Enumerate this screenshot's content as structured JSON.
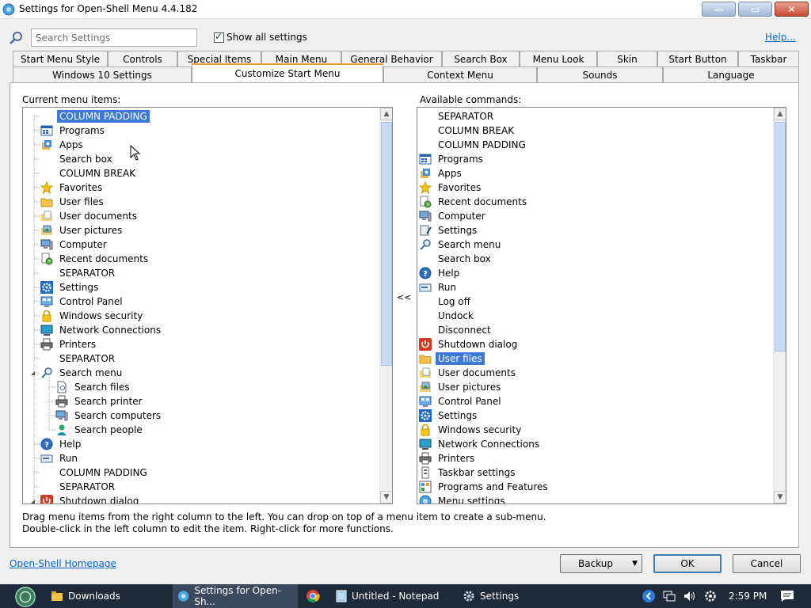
{
  "window": {
    "title": "Settings for Open-Shell Menu 4.4.182",
    "min_label": "—",
    "max_label": "▭",
    "close_label": "✕"
  },
  "search": {
    "placeholder": "Search Settings",
    "show_all_label": "Show all settings",
    "help_label": "Help..."
  },
  "tabs_row1": [
    "Start Menu Style",
    "Controls",
    "Special Items",
    "Main Menu",
    "General Behavior",
    "Search Box",
    "Menu Look",
    "Skin",
    "Start Button",
    "Taskbar"
  ],
  "tabs_row2": [
    "Windows 10 Settings",
    "Customize Start Menu",
    "Context Menu",
    "Sounds",
    "Language"
  ],
  "current": {
    "label": "Current menu items:",
    "items": [
      {
        "text": "COLUMN PADDING",
        "icon": "none"
      },
      {
        "text": "Programs",
        "icon": "programs"
      },
      {
        "text": "Apps",
        "icon": "apps"
      },
      {
        "text": "Search box",
        "icon": "none"
      },
      {
        "text": "COLUMN BREAK",
        "icon": "none"
      },
      {
        "text": "Favorites",
        "icon": "star"
      },
      {
        "text": "User files",
        "icon": "folder"
      },
      {
        "text": "User documents",
        "icon": "docs"
      },
      {
        "text": "User pictures",
        "icon": "pictures"
      },
      {
        "text": "Computer",
        "icon": "computer"
      },
      {
        "text": "Recent documents",
        "icon": "recent"
      },
      {
        "text": "SEPARATOR",
        "icon": "none"
      },
      {
        "text": "Settings",
        "icon": "gear"
      },
      {
        "text": "Control Panel",
        "icon": "control"
      },
      {
        "text": "Windows security",
        "icon": "lock"
      },
      {
        "text": "Network Connections",
        "icon": "network"
      },
      {
        "text": "Printers",
        "icon": "printer"
      },
      {
        "text": "SEPARATOR",
        "icon": "none"
      },
      {
        "text": "Search menu",
        "icon": "search"
      },
      {
        "text": "Search files",
        "icon": "file",
        "child": true
      },
      {
        "text": "Search printer",
        "icon": "printer",
        "child": true
      },
      {
        "text": "Search computers",
        "icon": "computer",
        "child": true
      },
      {
        "text": "Search people",
        "icon": "people",
        "child": true
      },
      {
        "text": "Help",
        "icon": "help"
      },
      {
        "text": "Run",
        "icon": "run"
      },
      {
        "text": "COLUMN PADDING",
        "icon": "none"
      },
      {
        "text": "SEPARATOR",
        "icon": "none"
      },
      {
        "text": "Shutdown dialog",
        "icon": "shutdown"
      }
    ]
  },
  "available": {
    "label": "Available commands:",
    "items": [
      {
        "text": "SEPARATOR",
        "icon": "none"
      },
      {
        "text": "COLUMN BREAK",
        "icon": "none"
      },
      {
        "text": "COLUMN PADDING",
        "icon": "none"
      },
      {
        "text": "Programs",
        "icon": "programs"
      },
      {
        "text": "Apps",
        "icon": "apps"
      },
      {
        "text": "Favorites",
        "icon": "star"
      },
      {
        "text": "Recent documents",
        "icon": "recent"
      },
      {
        "text": "Computer",
        "icon": "computer"
      },
      {
        "text": "Settings",
        "icon": "settings2"
      },
      {
        "text": "Search menu",
        "icon": "search"
      },
      {
        "text": "Search box",
        "icon": "none"
      },
      {
        "text": "Help",
        "icon": "help"
      },
      {
        "text": "Run",
        "icon": "run"
      },
      {
        "text": "Log off",
        "icon": "none"
      },
      {
        "text": "Undock",
        "icon": "none"
      },
      {
        "text": "Disconnect",
        "icon": "none"
      },
      {
        "text": "Shutdown dialog",
        "icon": "shutdown"
      },
      {
        "text": "User files",
        "icon": "folder"
      },
      {
        "text": "User documents",
        "icon": "docs"
      },
      {
        "text": "User pictures",
        "icon": "pictures"
      },
      {
        "text": "Control Panel",
        "icon": "control"
      },
      {
        "text": "Settings",
        "icon": "gear"
      },
      {
        "text": "Windows security",
        "icon": "lock"
      },
      {
        "text": "Network Connections",
        "icon": "network"
      },
      {
        "text": "Printers",
        "icon": "printer"
      },
      {
        "text": "Taskbar settings",
        "icon": "taskbar"
      },
      {
        "text": "Programs and Features",
        "icon": "features"
      },
      {
        "text": "Menu settings",
        "icon": "menusettings"
      }
    ]
  },
  "move_label": "<<",
  "hints": [
    "Drag menu items from the right column to the left. You can drop on top of a menu item to create a sub-menu.",
    "Double-click in the left column to edit the item. Right-click for more functions."
  ],
  "footer": {
    "homepage_label": "Open-Shell Homepage",
    "backup_label": "Backup",
    "ok_label": "OK",
    "cancel_label": "Cancel"
  },
  "taskbar": {
    "items": [
      "Downloads",
      "Settings for Open-Sh...",
      "",
      "Untitled - Notepad",
      "Settings"
    ],
    "clock": "2:59 PM"
  },
  "colors": {
    "selection": "#3d79d6",
    "tab_accent": "#f0a030",
    "taskbar": "#1d2a3a",
    "link": "#0066cc"
  }
}
